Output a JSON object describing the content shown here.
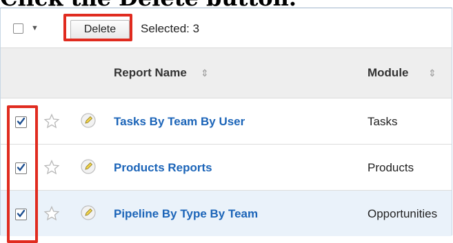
{
  "heading": "Click the Delete button.",
  "toolbar": {
    "delete_label": "Delete",
    "selected_text": "Selected: 3"
  },
  "columns": {
    "report_name": "Report Name",
    "module": "Module"
  },
  "rows": [
    {
      "name": "Tasks By Team By User",
      "module": "Tasks",
      "checked": true
    },
    {
      "name": "Products Reports",
      "module": "Products",
      "checked": true
    },
    {
      "name": "Pipeline By Type By Team",
      "module": "Opportunities",
      "checked": true
    }
  ],
  "colors": {
    "highlight": "#e02b1f",
    "link": "#1b64b8",
    "header_bg": "#eeeeee",
    "selected_row_bg": "#eaf2fa"
  }
}
